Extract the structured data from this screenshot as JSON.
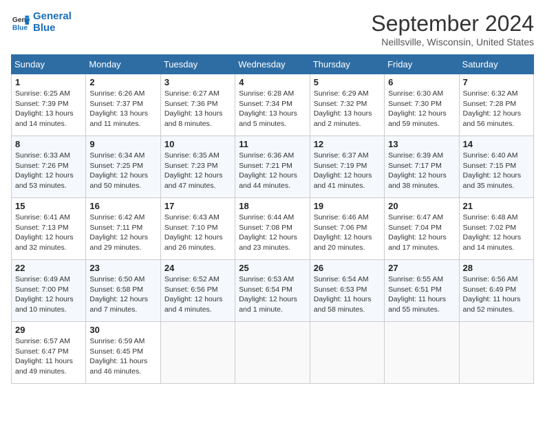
{
  "header": {
    "logo_line1": "General",
    "logo_line2": "Blue",
    "month_title": "September 2024",
    "location": "Neillsville, Wisconsin, United States"
  },
  "weekdays": [
    "Sunday",
    "Monday",
    "Tuesday",
    "Wednesday",
    "Thursday",
    "Friday",
    "Saturday"
  ],
  "weeks": [
    [
      {
        "day": "1",
        "sunrise": "6:25 AM",
        "sunset": "7:39 PM",
        "daylight": "13 hours and 14 minutes."
      },
      {
        "day": "2",
        "sunrise": "6:26 AM",
        "sunset": "7:37 PM",
        "daylight": "13 hours and 11 minutes."
      },
      {
        "day": "3",
        "sunrise": "6:27 AM",
        "sunset": "7:36 PM",
        "daylight": "13 hours and 8 minutes."
      },
      {
        "day": "4",
        "sunrise": "6:28 AM",
        "sunset": "7:34 PM",
        "daylight": "13 hours and 5 minutes."
      },
      {
        "day": "5",
        "sunrise": "6:29 AM",
        "sunset": "7:32 PM",
        "daylight": "13 hours and 2 minutes."
      },
      {
        "day": "6",
        "sunrise": "6:30 AM",
        "sunset": "7:30 PM",
        "daylight": "12 hours and 59 minutes."
      },
      {
        "day": "7",
        "sunrise": "6:32 AM",
        "sunset": "7:28 PM",
        "daylight": "12 hours and 56 minutes."
      }
    ],
    [
      {
        "day": "8",
        "sunrise": "6:33 AM",
        "sunset": "7:26 PM",
        "daylight": "12 hours and 53 minutes."
      },
      {
        "day": "9",
        "sunrise": "6:34 AM",
        "sunset": "7:25 PM",
        "daylight": "12 hours and 50 minutes."
      },
      {
        "day": "10",
        "sunrise": "6:35 AM",
        "sunset": "7:23 PM",
        "daylight": "12 hours and 47 minutes."
      },
      {
        "day": "11",
        "sunrise": "6:36 AM",
        "sunset": "7:21 PM",
        "daylight": "12 hours and 44 minutes."
      },
      {
        "day": "12",
        "sunrise": "6:37 AM",
        "sunset": "7:19 PM",
        "daylight": "12 hours and 41 minutes."
      },
      {
        "day": "13",
        "sunrise": "6:39 AM",
        "sunset": "7:17 PM",
        "daylight": "12 hours and 38 minutes."
      },
      {
        "day": "14",
        "sunrise": "6:40 AM",
        "sunset": "7:15 PM",
        "daylight": "12 hours and 35 minutes."
      }
    ],
    [
      {
        "day": "15",
        "sunrise": "6:41 AM",
        "sunset": "7:13 PM",
        "daylight": "12 hours and 32 minutes."
      },
      {
        "day": "16",
        "sunrise": "6:42 AM",
        "sunset": "7:11 PM",
        "daylight": "12 hours and 29 minutes."
      },
      {
        "day": "17",
        "sunrise": "6:43 AM",
        "sunset": "7:10 PM",
        "daylight": "12 hours and 26 minutes."
      },
      {
        "day": "18",
        "sunrise": "6:44 AM",
        "sunset": "7:08 PM",
        "daylight": "12 hours and 23 minutes."
      },
      {
        "day": "19",
        "sunrise": "6:46 AM",
        "sunset": "7:06 PM",
        "daylight": "12 hours and 20 minutes."
      },
      {
        "day": "20",
        "sunrise": "6:47 AM",
        "sunset": "7:04 PM",
        "daylight": "12 hours and 17 minutes."
      },
      {
        "day": "21",
        "sunrise": "6:48 AM",
        "sunset": "7:02 PM",
        "daylight": "12 hours and 14 minutes."
      }
    ],
    [
      {
        "day": "22",
        "sunrise": "6:49 AM",
        "sunset": "7:00 PM",
        "daylight": "12 hours and 10 minutes."
      },
      {
        "day": "23",
        "sunrise": "6:50 AM",
        "sunset": "6:58 PM",
        "daylight": "12 hours and 7 minutes."
      },
      {
        "day": "24",
        "sunrise": "6:52 AM",
        "sunset": "6:56 PM",
        "daylight": "12 hours and 4 minutes."
      },
      {
        "day": "25",
        "sunrise": "6:53 AM",
        "sunset": "6:54 PM",
        "daylight": "12 hours and 1 minute."
      },
      {
        "day": "26",
        "sunrise": "6:54 AM",
        "sunset": "6:53 PM",
        "daylight": "11 hours and 58 minutes."
      },
      {
        "day": "27",
        "sunrise": "6:55 AM",
        "sunset": "6:51 PM",
        "daylight": "11 hours and 55 minutes."
      },
      {
        "day": "28",
        "sunrise": "6:56 AM",
        "sunset": "6:49 PM",
        "daylight": "11 hours and 52 minutes."
      }
    ],
    [
      {
        "day": "29",
        "sunrise": "6:57 AM",
        "sunset": "6:47 PM",
        "daylight": "11 hours and 49 minutes."
      },
      {
        "day": "30",
        "sunrise": "6:59 AM",
        "sunset": "6:45 PM",
        "daylight": "11 hours and 46 minutes."
      },
      null,
      null,
      null,
      null,
      null
    ]
  ]
}
